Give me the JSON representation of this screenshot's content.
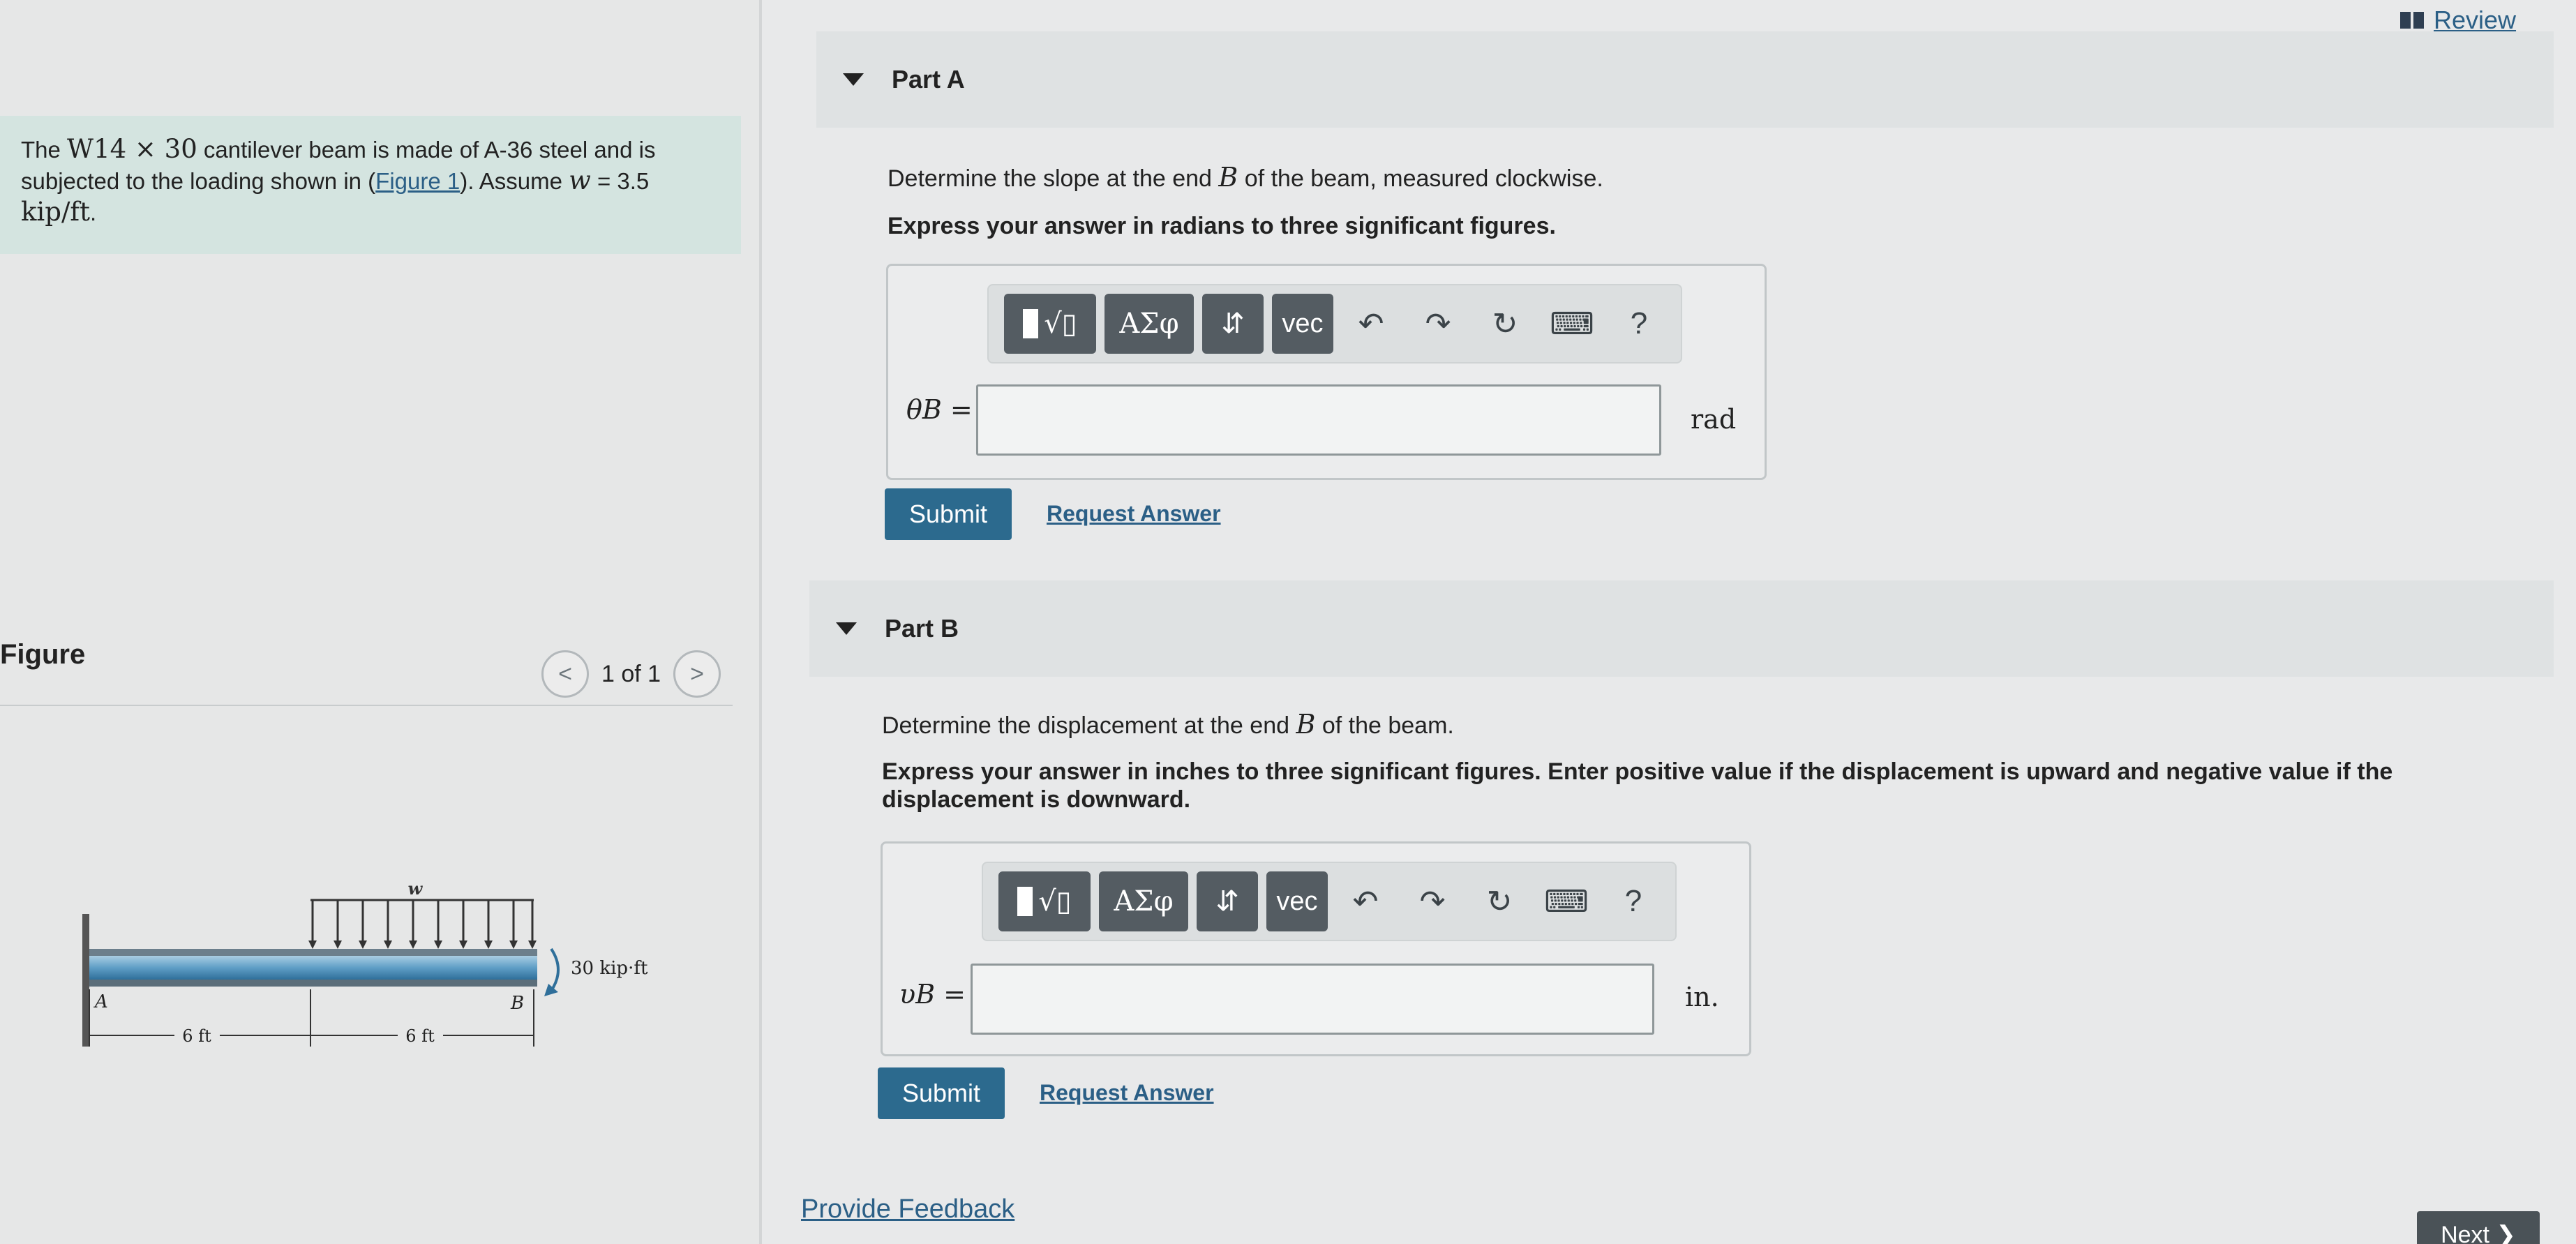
{
  "header": {
    "review_label": "Review"
  },
  "problem": {
    "text_1": "The ",
    "section": "W14 × 30",
    "text_2": " cantilever beam is made of A-36 steel and is subjected to the loading shown in (",
    "figure_link": "Figure 1",
    "text_3": "). Assume ",
    "w_var": "w",
    "text_4": " = 3.5 ",
    "units": "kip/ft",
    "text_5": "."
  },
  "figure": {
    "title": "Figure",
    "pager_text": "1 of 1",
    "labels": {
      "load": "w",
      "moment": "30 kip·ft",
      "end_a": "A",
      "end_b": "B",
      "span_1": "6 ft",
      "span_2": "6 ft"
    }
  },
  "part_a": {
    "title": "Part A",
    "question_1": "Determine the slope at the end ",
    "question_var": "B",
    "question_2": " of the beam, measured clockwise.",
    "instruction": "Express your answer in radians to three significant figures.",
    "var_label": "θB =",
    "input_value": "",
    "unit": "rad",
    "submit_label": "Submit",
    "request_label": "Request Answer"
  },
  "part_b": {
    "title": "Part B",
    "question_1": "Determine the displacement at the end ",
    "question_var": "B",
    "question_2": " of the beam.",
    "instruction": "Express your answer in inches to three significant figures. Enter positive value if the displacement is upward and negative value if the displacement is downward.",
    "var_label": "υB =",
    "input_value": "",
    "unit": "in.",
    "submit_label": "Submit",
    "request_label": "Request Answer"
  },
  "toolbar": {
    "greek_label": "ΑΣφ",
    "arrows_label": "⇵",
    "vec_label": "vec",
    "help_label": "?"
  },
  "footer": {
    "feedback_label": "Provide Feedback",
    "next_label": "Next ❯"
  }
}
